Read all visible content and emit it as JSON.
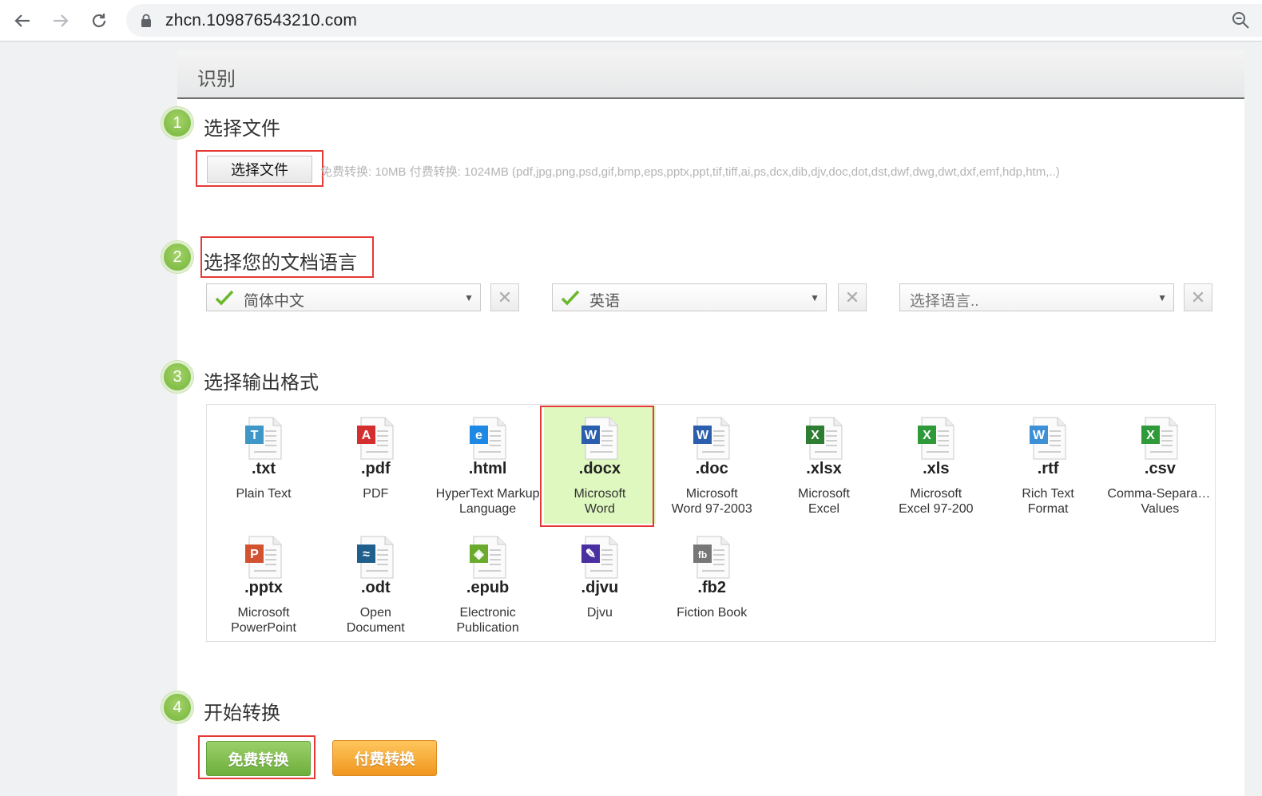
{
  "browser": {
    "url": "zhcn.109876543210.com"
  },
  "panel": {
    "title": "识别"
  },
  "steps": [
    {
      "number": "1",
      "title": "选择文件"
    },
    {
      "number": "2",
      "title": "选择您的文档语言"
    },
    {
      "number": "3",
      "title": "选择输出格式"
    },
    {
      "number": "4",
      "title": "开始转换"
    }
  ],
  "file": {
    "button_label": "选择文件",
    "hint": "免费转换: 10MB  付费转换: 1024MB    (pdf,jpg,png,psd,gif,bmp,eps,pptx,ppt,tif,tiff,ai,ps,dcx,dib,djv,doc,dot,dst,dwf,dwg,dwt,dxf,emf,hdp,htm,..)"
  },
  "languages": [
    {
      "value": "简体中文",
      "selected": true
    },
    {
      "value": "英语",
      "selected": true
    },
    {
      "value": "选择语言..",
      "selected": false
    }
  ],
  "colors": {
    "accent_green": "#74b53a",
    "selected_bg": "#dff8c0",
    "highlight_red": "#e53935",
    "paid_orange": "#f0961f"
  },
  "formats": [
    {
      "ext": ".txt",
      "desc1": "Plain Text",
      "desc2": "",
      "icon": "text-file-icon",
      "color": "#3e97c6",
      "glyph": "T"
    },
    {
      "ext": ".pdf",
      "desc1": "PDF",
      "desc2": "",
      "icon": "pdf-file-icon",
      "color": "#d32f2f",
      "glyph": "A"
    },
    {
      "ext": ".html",
      "desc1": "HyperText Markup",
      "desc2": "Language",
      "icon": "html-file-icon",
      "color": "#1e88e5",
      "glyph": "e"
    },
    {
      "ext": ".docx",
      "desc1": "Microsoft",
      "desc2": "Word",
      "icon": "word-file-icon",
      "color": "#2b5fad",
      "glyph": "W",
      "selected": true
    },
    {
      "ext": ".doc",
      "desc1": "Microsoft",
      "desc2": "Word 97-2003",
      "icon": "word-file-icon",
      "color": "#2b5fad",
      "glyph": "W"
    },
    {
      "ext": ".xlsx",
      "desc1": "Microsoft",
      "desc2": "Excel",
      "icon": "excel-file-icon",
      "color": "#2e7d32",
      "glyph": "X"
    },
    {
      "ext": ".xls",
      "desc1": "Microsoft",
      "desc2": "Excel 97-200",
      "icon": "excel-file-icon",
      "color": "#2e9a3a",
      "glyph": "X"
    },
    {
      "ext": ".rtf",
      "desc1": "Rich Text",
      "desc2": "Format",
      "icon": "rtf-file-icon",
      "color": "#3d8fd6",
      "glyph": "W"
    },
    {
      "ext": ".csv",
      "desc1": "Comma-Separated",
      "desc2": "Values",
      "icon": "csv-file-icon",
      "color": "#2e9a3a",
      "glyph": "X"
    },
    {
      "ext": ".pptx",
      "desc1": "Microsoft",
      "desc2": "PowerPoint",
      "icon": "powerpoint-file-icon",
      "color": "#d35230",
      "glyph": "P"
    },
    {
      "ext": ".odt",
      "desc1": "Open",
      "desc2": "Document",
      "icon": "odt-file-icon",
      "color": "#1f5f8b",
      "glyph": "≈"
    },
    {
      "ext": ".epub",
      "desc1": "Electronic",
      "desc2": "Publication",
      "icon": "epub-file-icon",
      "color": "#6aab2e",
      "glyph": "◈"
    },
    {
      "ext": ".djvu",
      "desc1": "Djvu",
      "desc2": "",
      "icon": "djvu-file-icon",
      "color": "#4a2fa0",
      "glyph": "✎"
    },
    {
      "ext": ".fb2",
      "desc1": "Fiction Book",
      "desc2": "",
      "icon": "fb2-file-icon",
      "color": "#777777",
      "glyph": "fb"
    }
  ],
  "actions": {
    "free_label": "免费转换",
    "paid_label": "付费转换"
  }
}
